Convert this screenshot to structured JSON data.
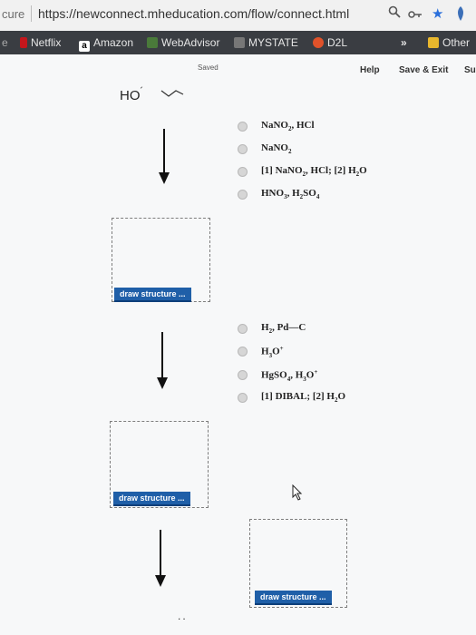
{
  "browser": {
    "secure_label": "cure",
    "url": "https://newconnect.mhedducation.com/flow/connect.html",
    "url_display": "https://newconnect.mheducation.com/flow/connect.html"
  },
  "bookmarks": [
    {
      "label": "Netflix",
      "icon": "netflix-icon",
      "color": "#c4161c"
    },
    {
      "label": "Amazon",
      "icon": "amazon-icon",
      "color": "#ffffff"
    },
    {
      "label": "WebAdvisor",
      "icon": "webadvisor-icon",
      "color": "#4a7a3a"
    },
    {
      "label": "MYSTATE",
      "icon": "mystate-icon",
      "color": "#777777"
    },
    {
      "label": "D2L",
      "icon": "d2l-icon",
      "color": "#e0522a"
    }
  ],
  "bookmarks_overflow": "»",
  "bookmarks_other": "Other",
  "toolbar": {
    "saved": "Saved",
    "help": "Help",
    "save_exit": "Save & Exit",
    "submit_partial": "Su"
  },
  "reactant": {
    "label": "HO"
  },
  "step1_options": [
    {
      "html": "NaNO<sub>2</sub>, HCl"
    },
    {
      "html": "NaNO<sub>2</sub>"
    },
    {
      "html": "[1] NaNO<sub>2</sub>, HCl; [2] H<sub>2</sub>O"
    },
    {
      "html": "HNO<sub>3</sub>, H<sub>2</sub>SO<sub>4</sub>"
    }
  ],
  "step2_options": [
    {
      "html": "H<sub>2</sub>, Pd—C"
    },
    {
      "html": "H<sub>3</sub>O<sup>+</sup>"
    },
    {
      "html": "HgSO<sub>4</sub>, H<sub>3</sub>O<sup>+</sup>"
    },
    {
      "html": "[1] DIBAL; [2] H<sub>2</sub>O"
    }
  ],
  "draw_button_label": "draw structure ...",
  "dots": ".."
}
